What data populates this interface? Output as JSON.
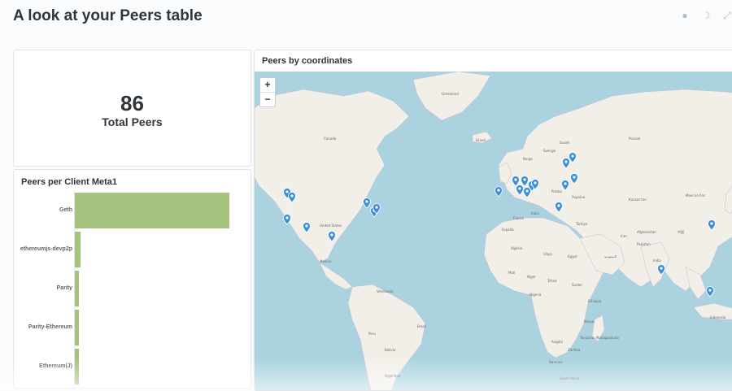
{
  "header": {
    "title": "A look at your Peers table",
    "actions": [
      "info-icon",
      "moon-icon",
      "fullscreen-icon"
    ]
  },
  "scalar": {
    "value": "86",
    "label": "Total Peers"
  },
  "bar_chart": {
    "title": "Peers per Client Meta1"
  },
  "chart_data": {
    "type": "bar",
    "orientation": "horizontal",
    "title": "Peers per Client Meta1",
    "categories": [
      "Geth",
      "ethereumjs-devp2p",
      "Parity",
      "Parity-Ethereum",
      "Ethereum(J)"
    ],
    "values": [
      55,
      2,
      1,
      1,
      1
    ],
    "color": "#a6c27f"
  },
  "map": {
    "title": "Peers by coordinates",
    "zoom_in": "+",
    "zoom_out": "−",
    "labels": [
      "Canada",
      "United States",
      "Mexico",
      "Venezuela",
      "Brasil",
      "Peru",
      "Bolivia",
      "Argentina",
      "Ísland",
      "Norge",
      "Sverige",
      "Suomi",
      "Polska",
      "Україна",
      "France",
      "España",
      "Italia",
      "Türkiye",
      "Россия",
      "Казахстан",
      "Монгол Улс",
      "中国",
      "日本",
      "India",
      "Algérie",
      "Libya",
      "Egypt",
      "Mali",
      "Niger",
      "Tchad",
      "Sudan",
      "Nigeria",
      "Ethiopia",
      "Kenya",
      "Tanzania",
      "Angola",
      "Zambia",
      "Namibia",
      "South Africa",
      "Madagasikara",
      "Indonesia",
      "السعودية",
      "Iran",
      "Pakistan",
      "Afghanistan",
      "Greenland"
    ],
    "water_color": "#aad3df",
    "land_color": "#f2efe9",
    "marker_color": "#3a8fd6"
  }
}
